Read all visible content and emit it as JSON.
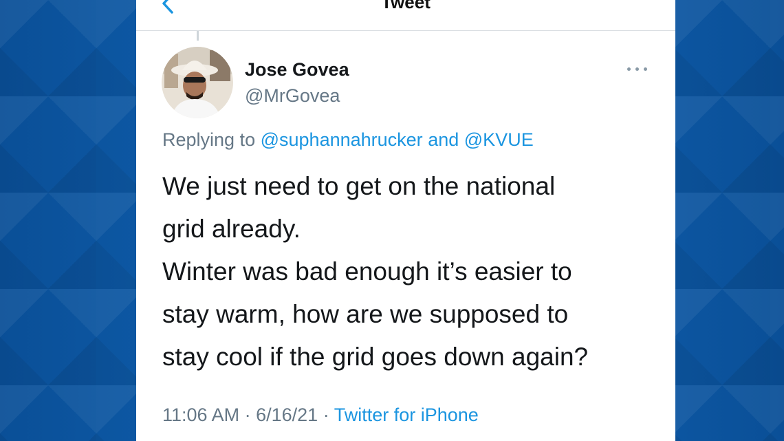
{
  "header": {
    "title": "Tweet",
    "back_icon": "chevron-left-icon"
  },
  "author": {
    "display_name": "Jose Govea",
    "handle": "@MrGovea",
    "avatar_icon": "avatar-photo"
  },
  "reply": {
    "prefix": "Replying to",
    "mention_1": "@suphannahrucker",
    "joiner": "and",
    "mention_2": "@KVUE"
  },
  "tweet": {
    "lines": [
      "We just need to get on the national",
      "grid already.",
      "Winter was bad enough it’s easier to",
      "stay warm, how are we supposed to",
      "stay cool if the grid goes down again?"
    ]
  },
  "meta": {
    "time": "11:06 AM",
    "separator": "·",
    "date": "6/16/21",
    "source": "Twitter for iPhone"
  },
  "colors": {
    "accent": "#1b95e0",
    "secondary_text": "#657786",
    "background_blue": "#0d5aa7"
  }
}
